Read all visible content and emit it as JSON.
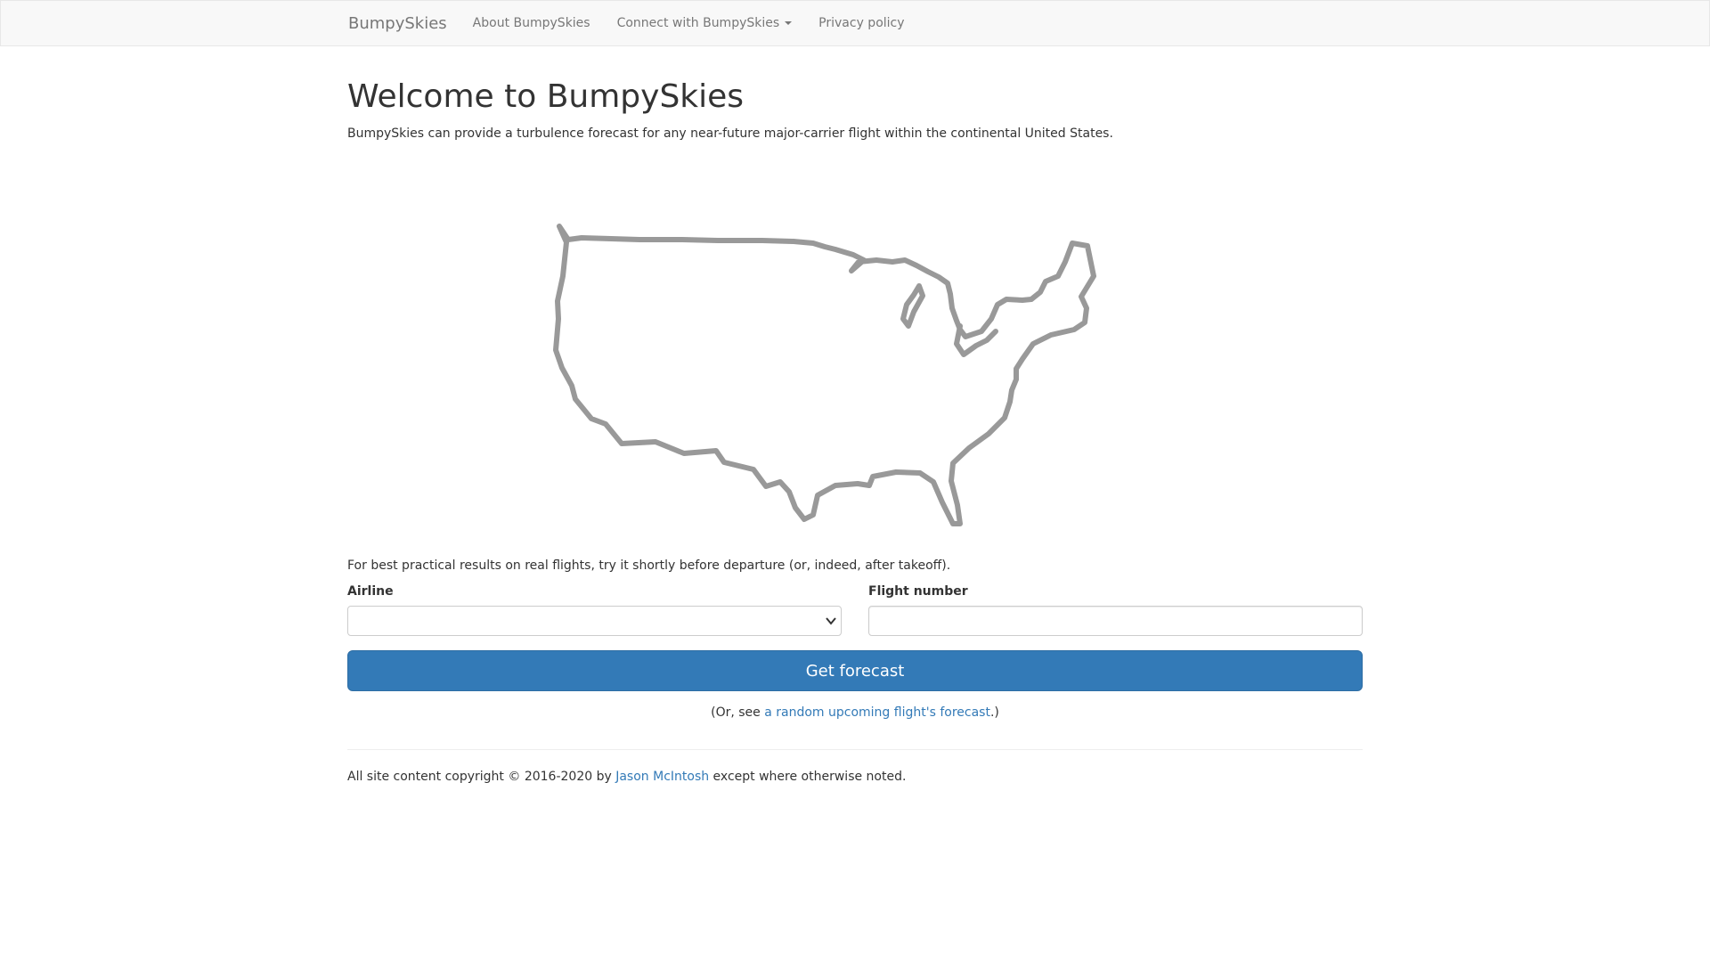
{
  "navbar": {
    "brand": "BumpySkies",
    "links": [
      "About BumpySkies",
      "Connect with BumpySkies",
      "Privacy policy"
    ]
  },
  "main": {
    "title": "Welcome to BumpySkies",
    "intro": "BumpySkies can provide a turbulence forecast for any near-future major-carrier flight within the continental United States.",
    "tip": "For best practical results on real flights, try it shortly before departure (or, indeed, after takeoff).",
    "form": {
      "airline_label": "Airline",
      "airline_value": "",
      "flight_label": "Flight number",
      "flight_value": "",
      "submit_label": "Get forecast"
    },
    "random": {
      "prefix": "(Or, see ",
      "link_text": "a random upcoming flight's forecast",
      "suffix": ".)"
    }
  },
  "footer": {
    "prefix": "All site content copyright © 2016-2020 by ",
    "author": "Jason McIntosh",
    "suffix": " except where otherwise noted."
  },
  "colors": {
    "primary": "#337ab7",
    "map_outline": "#999999",
    "navbar_bg": "#f8f8f8"
  },
  "icons": {
    "map": "us-map-outline-icon",
    "dropdown": "caret-down-icon"
  }
}
